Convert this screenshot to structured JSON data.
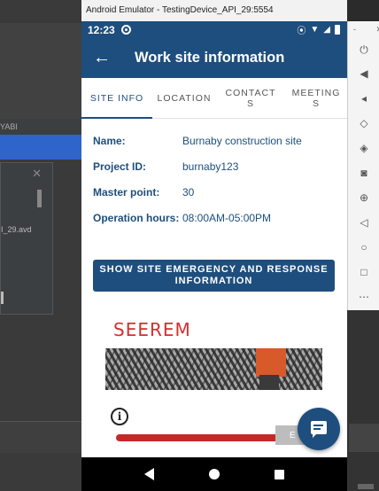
{
  "emulator": {
    "window_title": "Android Emulator - TestingDevice_API_29:5554"
  },
  "ide": {
    "abi_label": "YABI",
    "avd_label": "I_29.avd"
  },
  "status_bar": {
    "time": "12:23"
  },
  "app_bar": {
    "title": "Work site information"
  },
  "tabs": [
    {
      "label": "SITE INFO"
    },
    {
      "label": "LOCATION"
    },
    {
      "label": "CONTACT\nS"
    },
    {
      "label": "MEETING\nS"
    }
  ],
  "site_info": {
    "rows": [
      {
        "key": "Name:",
        "value": "Burnaby construction site"
      },
      {
        "key": "Project ID:",
        "value": "burnaby123"
      },
      {
        "key": "Master point:",
        "value": "30"
      },
      {
        "key": "Operation hours:",
        "value": "08:00AM-05:00PM"
      }
    ]
  },
  "emergency_button": {
    "label": "SHOW SITE EMERGENCY AND RESPONSE INFORMATION"
  },
  "brand": {
    "logo_text": "SEEREM"
  },
  "chip": {
    "text": "E"
  },
  "colors": {
    "primary": "#1e4e7d",
    "accent_red": "#c62828"
  }
}
